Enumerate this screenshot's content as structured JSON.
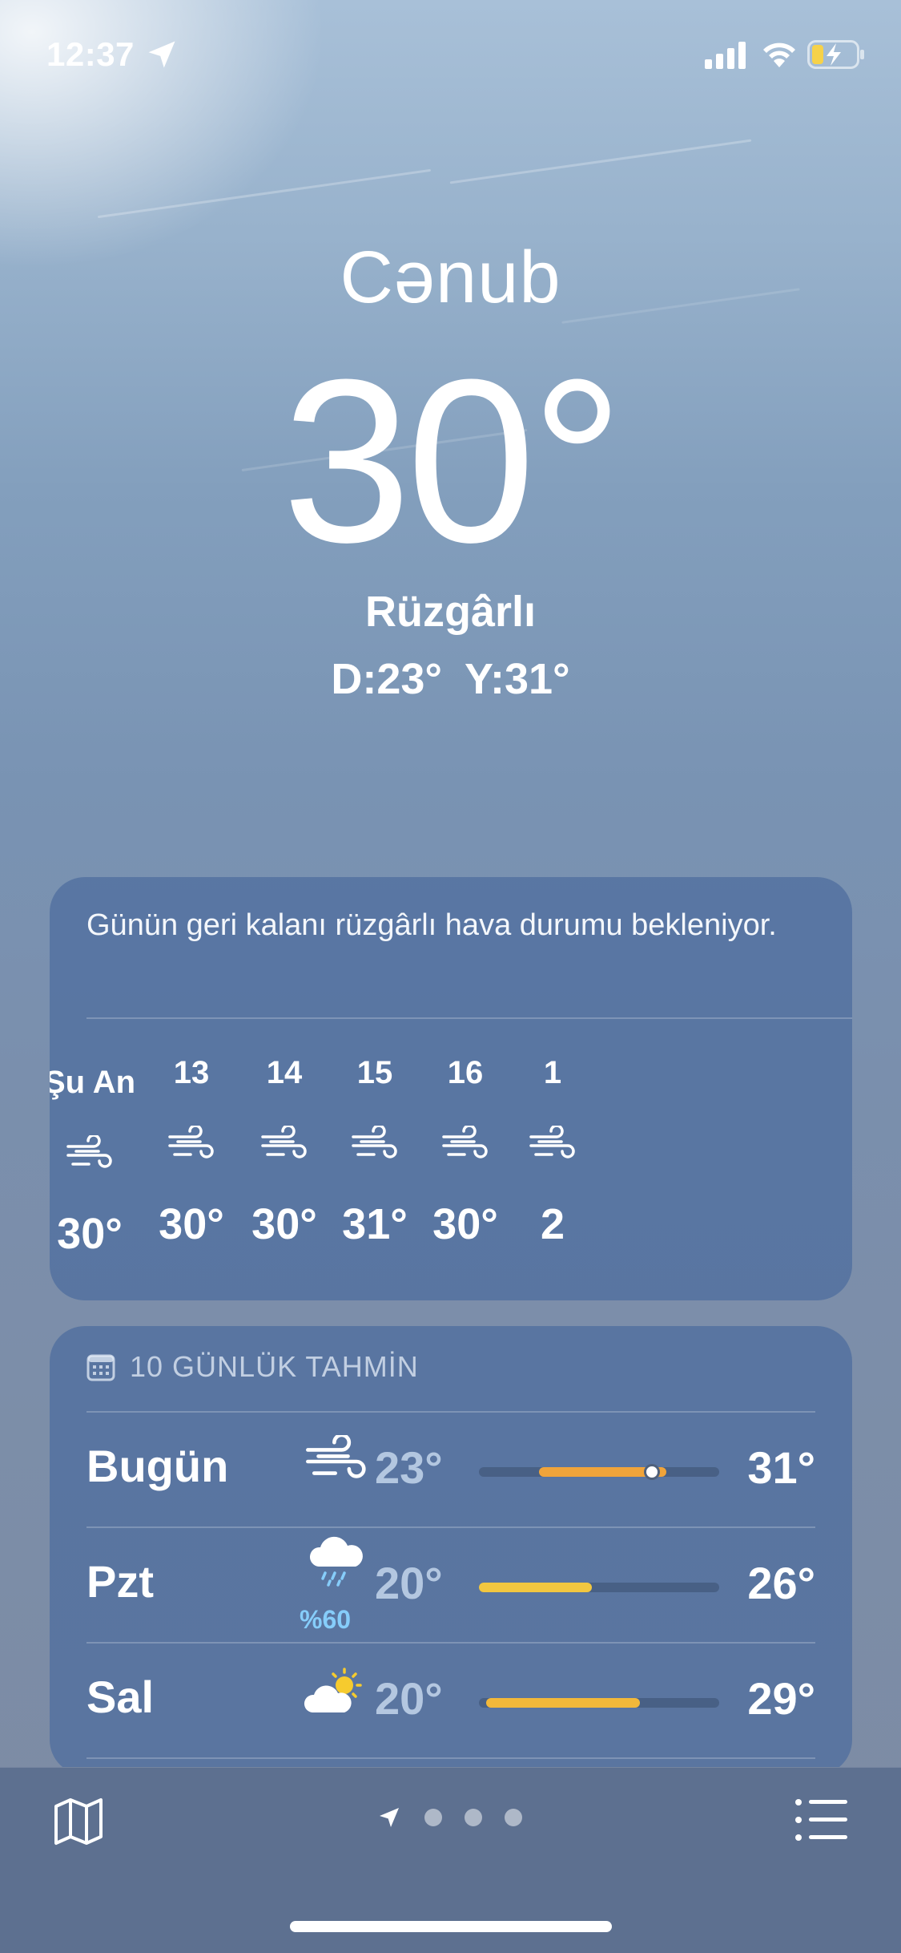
{
  "status": {
    "time": "12:37"
  },
  "hero": {
    "city": "Cənub",
    "temperature": "30",
    "degree": "°",
    "condition": "Rüzgârlı",
    "low": "D:23°",
    "high": "Y:31°"
  },
  "hourly": {
    "summary": "Günün geri kalanı rüzgârlı hava durumu bekleniyor.",
    "items": [
      {
        "label": "Şu An",
        "icon": "wind-icon",
        "temp": "30°"
      },
      {
        "label": "13",
        "icon": "wind-icon",
        "temp": "30°"
      },
      {
        "label": "14",
        "icon": "wind-icon",
        "temp": "30°"
      },
      {
        "label": "15",
        "icon": "wind-icon",
        "temp": "31°"
      },
      {
        "label": "16",
        "icon": "wind-icon",
        "temp": "30°"
      },
      {
        "label": "1",
        "icon": "wind-icon",
        "temp": "2"
      }
    ]
  },
  "daily": {
    "header": "10 GÜNLÜK TAHMİN",
    "days": [
      {
        "name": "Bugün",
        "icon": "wind-icon",
        "precip": "",
        "low": "23°",
        "high": "31°",
        "range_start": 0.25,
        "range_end": 0.78,
        "current": 0.72,
        "color": "#f0a43a"
      },
      {
        "name": "Pzt",
        "icon": "cloud-rain-icon",
        "precip": "%60",
        "low": "20°",
        "high": "26°",
        "range_start": 0.0,
        "range_end": 0.47,
        "current": null,
        "color": "#f2c740"
      },
      {
        "name": "Sal",
        "icon": "partly-sunny-icon",
        "precip": "",
        "low": "20°",
        "high": "29°",
        "range_start": 0.03,
        "range_end": 0.67,
        "current": null,
        "color": "#f2b83a"
      }
    ]
  },
  "colors": {
    "card": "#4c6c9e",
    "bottom_bar": "#5d7090",
    "precip": "#86cdfa"
  }
}
